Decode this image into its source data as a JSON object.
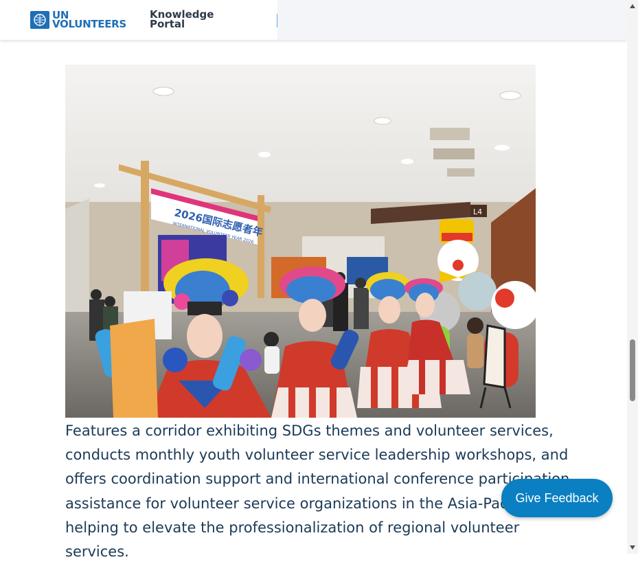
{
  "header": {
    "logo_line1": "UN",
    "logo_line2": "VOLUNTEERS",
    "portal_line1": "Knowledge",
    "portal_line2": "Portal"
  },
  "image": {
    "banner_text_cn": "2026国际志愿者年",
    "banner_text_en": "INTERNATIONAL VOLUNTEER YEAR 2026",
    "floor_sign": "L4"
  },
  "article": {
    "paragraph": "Features a corridor exhibiting SDGs themes and volunteer services, conducts monthly youth volunteer service leadership workshops, and offers coordination support and international conference participation assistance for volunteer service organizations in the Asia-Pacific region, helping to elevate the professionalization of regional volunteer services."
  },
  "feedback_button": {
    "label": "Give Feedback"
  },
  "colors": {
    "brand_blue": "#1f6fb5",
    "text_navy": "#1b3a57",
    "button_blue": "#0a7fc2"
  },
  "icons": [
    "un-emblem-icon",
    "scroll-up-arrow-icon",
    "scroll-down-arrow-icon"
  ]
}
